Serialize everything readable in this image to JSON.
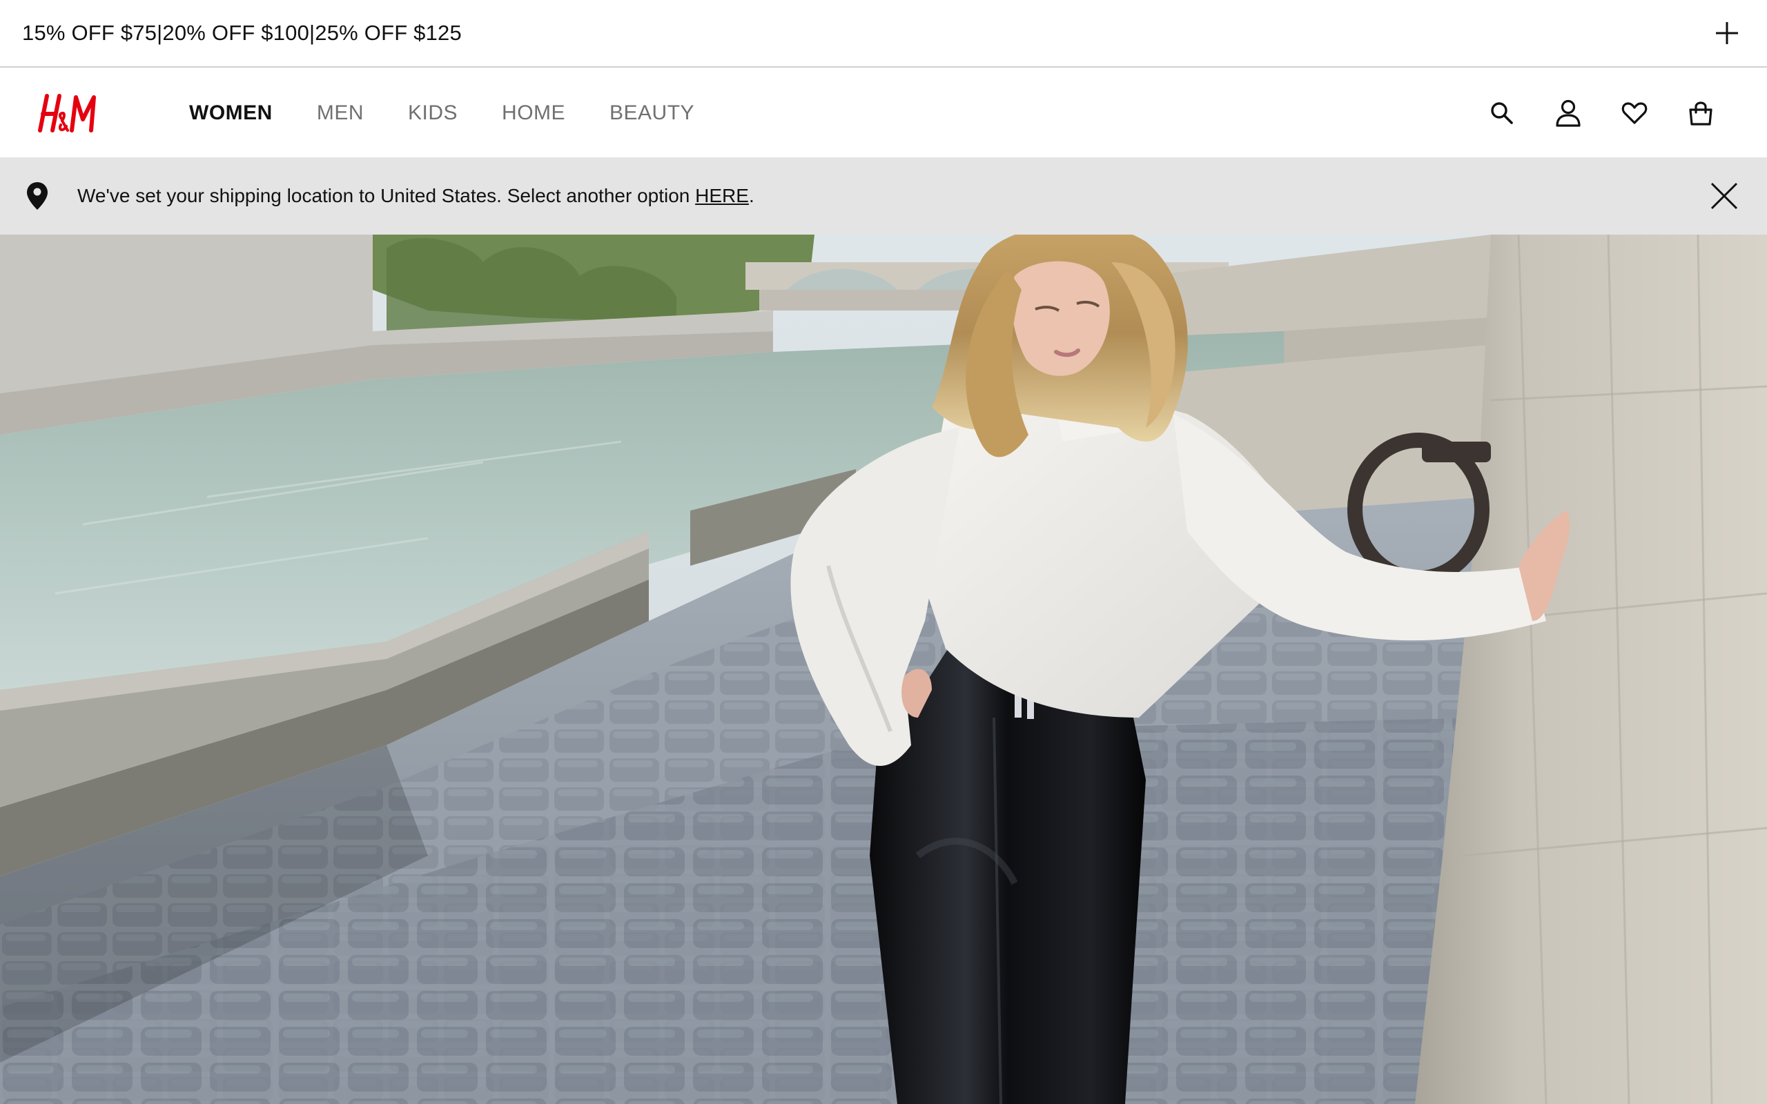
{
  "promo": {
    "text": "15% OFF $75|20% OFF $100|25% OFF $125",
    "expand_icon": "plus-icon"
  },
  "header": {
    "logo_text": "H&M",
    "logo_color": "#e50010",
    "nav": [
      {
        "label": "WOMEN",
        "active": true
      },
      {
        "label": "MEN",
        "active": false
      },
      {
        "label": "KIDS",
        "active": false
      },
      {
        "label": "HOME",
        "active": false
      },
      {
        "label": "BEAUTY",
        "active": false
      }
    ],
    "icons": [
      "search-icon",
      "account-icon",
      "favorites-icon",
      "shopping-bag-icon"
    ]
  },
  "shipping_banner": {
    "message": "We've set your shipping location to United States. Select another option ",
    "link": "HERE",
    "suffix": ".",
    "icons": [
      "location-pin-icon",
      "close-icon"
    ]
  },
  "colors": {
    "banner_bg": "#e4e4e4",
    "nav_active": "#111111",
    "nav_inactive": "#707070"
  }
}
